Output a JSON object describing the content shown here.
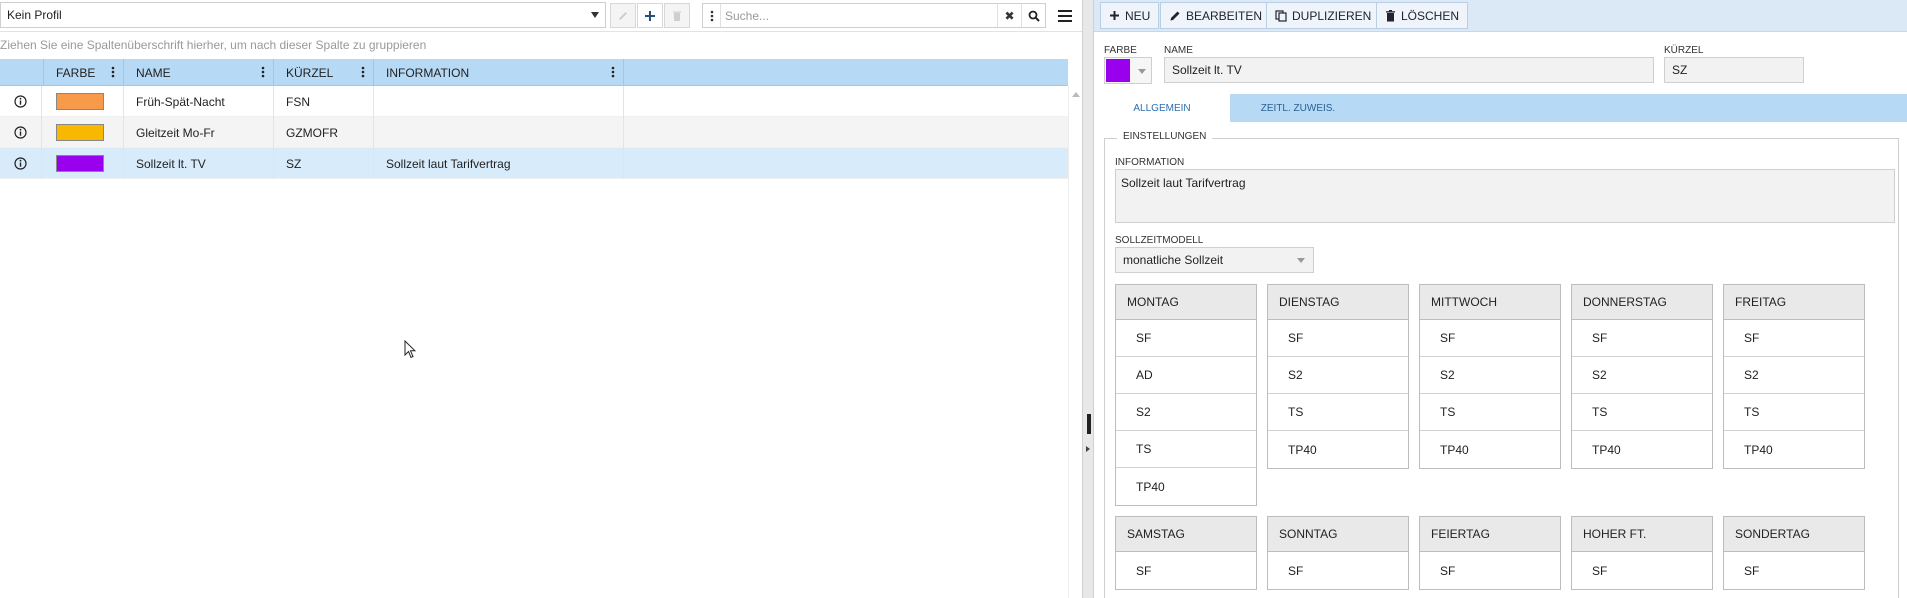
{
  "left": {
    "profile_select": {
      "value": "Kein Profil"
    },
    "search": {
      "placeholder": "Suche...",
      "clear": "✖"
    },
    "group_hint": "Ziehen Sie eine Spaltenüberschrift hierher, um nach dieser Spalte zu gruppieren",
    "columns": [
      "FARBE",
      "NAME",
      "KÜRZEL",
      "INFORMATION"
    ],
    "rows": [
      {
        "color": "#f79a4a",
        "name": "Früh-Spät-Nacht",
        "short": "FSN",
        "info": ""
      },
      {
        "color": "#f8b800",
        "name": "Gleitzeit Mo-Fr",
        "short": "GZMOFR",
        "info": ""
      },
      {
        "color": "#9900ee",
        "name": "Sollzeit lt. TV",
        "short": "SZ",
        "info": "Sollzeit laut Tarifvertrag"
      }
    ],
    "selected_row": 2
  },
  "right": {
    "toolbar": {
      "new": "NEU",
      "edit": "BEARBEITEN",
      "duplicate": "DUPLIZIEREN",
      "delete": "LÖSCHEN"
    },
    "labels": {
      "color": "FARBE",
      "name": "NAME",
      "short": "KÜRZEL"
    },
    "values": {
      "color": "#9900ee",
      "name": "Sollzeit lt. TV",
      "short": "SZ"
    },
    "tabs": [
      {
        "label": "ALLGEMEIN",
        "active": true
      },
      {
        "label": "ZEITL. ZUWEIS.",
        "active": false
      }
    ],
    "settings": {
      "legend": "EINSTELLUNGEN",
      "info_label": "INFORMATION",
      "info_value": "Sollzeit laut Tarifvertrag",
      "model_label": "SOLLZEITMODELL",
      "model_value": "monatliche Sollzeit"
    },
    "days_row1": [
      {
        "day": "MONTAG",
        "items": [
          "SF",
          "AD",
          "S2",
          "TS",
          "TP40"
        ]
      },
      {
        "day": "DIENSTAG",
        "items": [
          "SF",
          "S2",
          "TS",
          "TP40"
        ]
      },
      {
        "day": "MITTWOCH",
        "items": [
          "SF",
          "S2",
          "TS",
          "TP40"
        ]
      },
      {
        "day": "DONNERSTAG",
        "items": [
          "SF",
          "S2",
          "TS",
          "TP40"
        ]
      },
      {
        "day": "FREITAG",
        "items": [
          "SF",
          "S2",
          "TS",
          "TP40"
        ]
      }
    ],
    "days_row2": [
      {
        "day": "SAMSTAG",
        "items": [
          "SF"
        ]
      },
      {
        "day": "SONNTAG",
        "items": [
          "SF"
        ]
      },
      {
        "day": "FEIERTAG",
        "items": [
          "SF"
        ]
      },
      {
        "day": "HOHER FT.",
        "items": [
          "SF"
        ]
      },
      {
        "day": "SONDERTAG",
        "items": [
          "SF"
        ]
      }
    ]
  },
  "icons": {
    "pencil": "pencil-icon",
    "plus": "plus-icon",
    "trash": "trash-icon",
    "search": "search-icon",
    "menu": "hamburger-icon",
    "info": "info-icon",
    "kebab": "vertical-dots-icon",
    "copy": "copy-icon"
  }
}
